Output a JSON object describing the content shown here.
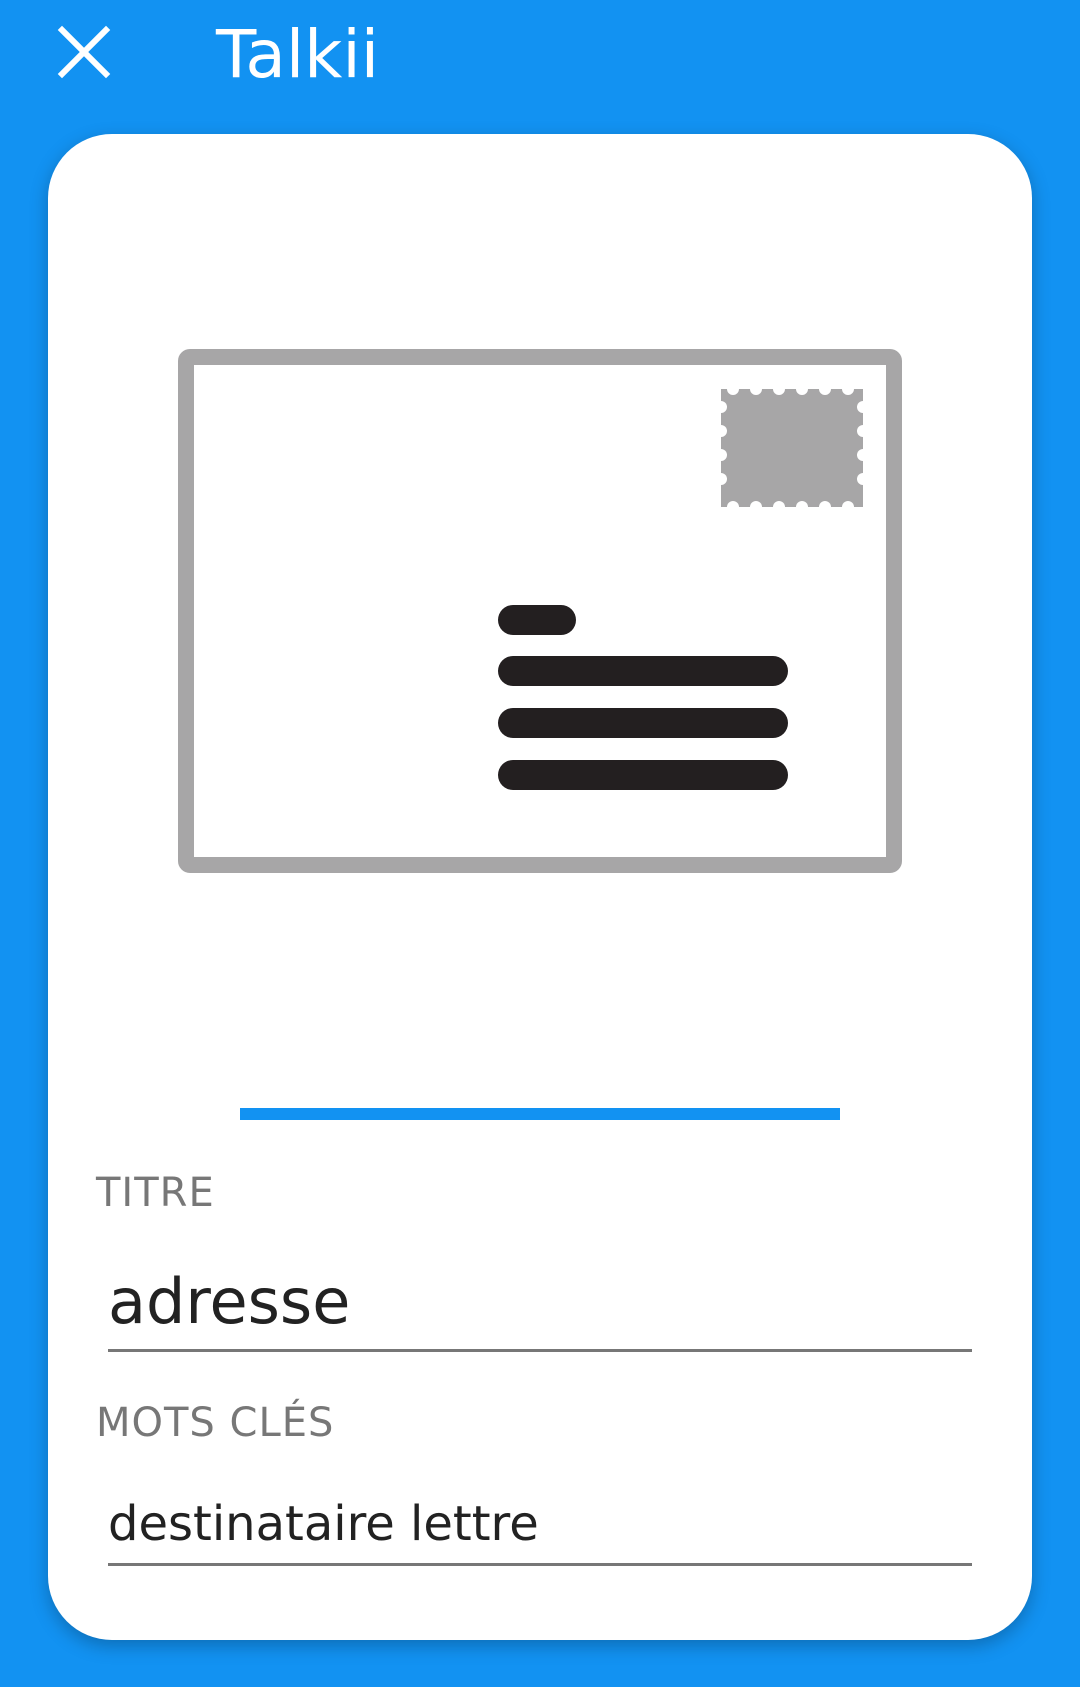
{
  "app_bar": {
    "title": "Talkii",
    "close_icon": "close-icon"
  },
  "card": {
    "illustration_icon": "envelope-icon",
    "progress": 1.0,
    "colors": {
      "accent": "#1292f2",
      "envelope_gray": "#a7a6a7",
      "text_lines": "#231f20"
    },
    "title_field": {
      "label": "TITRE",
      "value": "adresse"
    },
    "keywords_field": {
      "label": "MOTS CLÉS",
      "value": "destinataire lettre"
    }
  }
}
